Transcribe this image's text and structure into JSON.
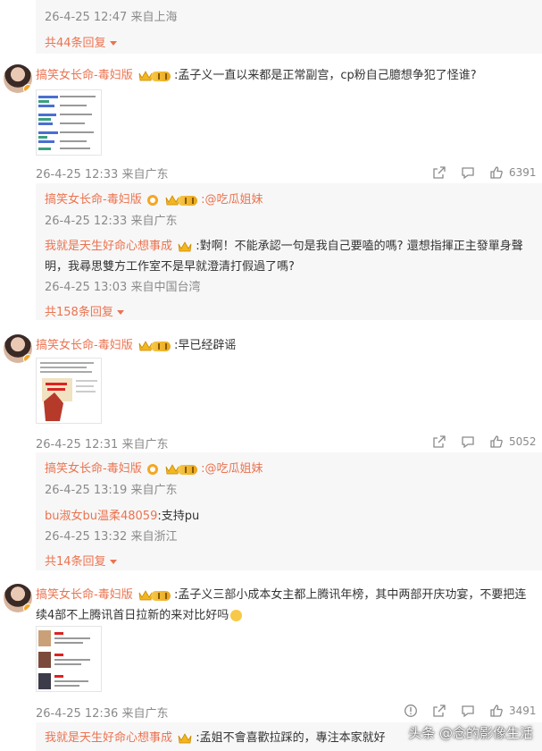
{
  "top": {
    "time": "26-4-25 12:47 来自上海",
    "more": "共44条回复"
  },
  "comments": [
    {
      "user": "搞笑女长命-毒妇版",
      "text": ":孟子义一直以来都是正常副宫，cp粉自己臆想争犯了怪谁?",
      "time": "26-4-25 12:33 来自广东",
      "likes": "6391",
      "replies": [
        {
          "user": "搞笑女长命-毒妇版",
          "text": ":@吃瓜姐妹",
          "time": "26-4-25 12:33 来自广东"
        },
        {
          "user": "我就是天生好命心想事成",
          "text": ":對啊！不能承認一句是我自己要嗑的嗎? 還想指揮正主發單身聲",
          "text2": "明，我尋思雙方工作室不是早就澄清打假過了嗎?",
          "time": "26-4-25 13:03 来自中国台湾"
        }
      ],
      "more": "共158条回复"
    },
    {
      "user": "搞笑女长命-毒妇版",
      "text": ":早已经辟谣",
      "time": "26-4-25 12:31 来自广东",
      "likes": "5052",
      "replies": [
        {
          "user": "搞笑女长命-毒妇版",
          "text": ":@吃瓜姐妹",
          "time": "26-4-25 13:19 来自广东"
        },
        {
          "user": "bu淑女bu温柔48059",
          "text": ":支持pu",
          "time": "26-4-25 13:32 来自浙江"
        }
      ],
      "more": "共14条回复"
    },
    {
      "user": "搞笑女长命-毒妇版",
      "text": ":孟子义三部小成本女主都上腾讯年榜，其中两部开庆功宴，不要把连",
      "text2": "续4部不上腾讯首日拉新的来对比好吗",
      "time": "26-4-25 12:36 来自广东",
      "likes": "3491",
      "replies": [
        {
          "user": "我就是天生好命心想事成",
          "text": ":孟姐不會喜歡拉踩的，專注本家就好"
        }
      ]
    }
  ],
  "watermark": "头条 @念的影像生活",
  "colors": {
    "accent": "#eb7350",
    "meta": "#8a8a8a",
    "reply_bg": "#f7f7f7"
  },
  "icons": [
    "crown-level-badge",
    "vip-verified-icon",
    "share-icon",
    "comment-icon",
    "like-icon",
    "warning-icon"
  ]
}
